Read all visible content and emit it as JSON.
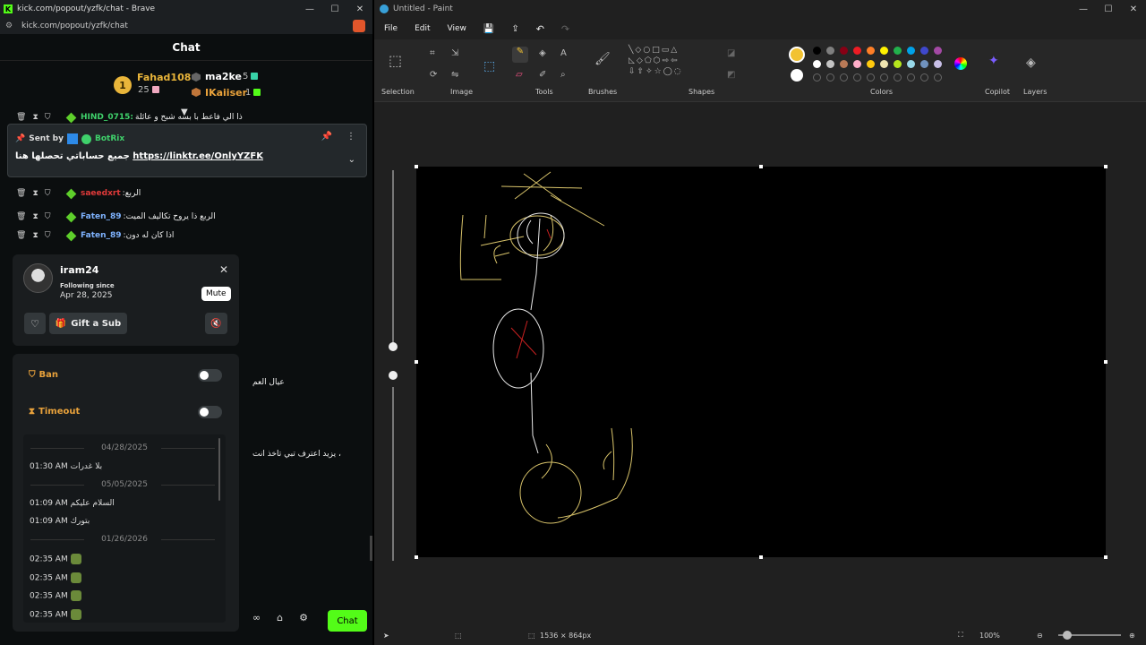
{
  "browser": {
    "title": "kick.com/popout/yzfk/chat - Brave",
    "url": "kick.com/popout/yzfk/chat",
    "window_controls": [
      "—",
      "☐",
      "✕"
    ]
  },
  "chat": {
    "header": "Chat",
    "leaderboard": {
      "first": {
        "rank": "1",
        "name": "Fahad108",
        "count": "25"
      },
      "second": {
        "name": "ma2ke",
        "count": "5"
      },
      "third": {
        "name": "IKaiiser",
        "count": "1"
      }
    },
    "cutoff_top_user": "HIND_0715:",
    "cutoff_top_text": "ذا الي فاعط با بسه شبح و عائلة",
    "pinned": {
      "sent_by": "Sent by",
      "bot_name": "BotRix",
      "text_arabic": "جميع حساباتي تحصلها هنا",
      "link": "https://linktr.ee/OnlyYZFK"
    },
    "messages": [
      {
        "user": "saeedxrt",
        "text": "الربع",
        "color": "#e03a3a"
      },
      {
        "user": "Faten_89",
        "text": "الربع ذا يروح تكاليف الميت",
        "color": "#7fb3ff"
      },
      {
        "user": "Faten_89",
        "text": "اذا كان له دون",
        "color": "#7fb3ff"
      }
    ],
    "side_text_1": "عيال العم",
    "side_text_2": "يزيد اعترف تبي تاخذ انت ،",
    "usercard": {
      "username": "iram24",
      "following_label": "Following since",
      "following_date": "Apr 28, 2025",
      "mute_tooltip": "Mute",
      "gift_label": "Gift a Sub"
    },
    "mod": {
      "ban_label": "Ban",
      "timeout_label": "Timeout"
    },
    "history": [
      {
        "date": "04/28/2025",
        "lines": [
          {
            "time": "01:30 AM",
            "text": "بلا غدرات"
          }
        ]
      },
      {
        "date": "05/05/2025",
        "lines": [
          {
            "time": "01:09 AM",
            "text": "السلام عليكم"
          },
          {
            "time": "01:09 AM",
            "text": "بتورك"
          }
        ]
      },
      {
        "date": "01/26/2026",
        "lines": [
          {
            "time": "02:35 AM",
            "text": ""
          },
          {
            "time": "02:35 AM",
            "text": ""
          },
          {
            "time": "02:35 AM",
            "text": ""
          },
          {
            "time": "02:35 AM",
            "text": ""
          }
        ]
      }
    ],
    "send_label": "Chat"
  },
  "paint": {
    "title": "Untitled - Paint",
    "menu": [
      "File",
      "Edit",
      "View"
    ],
    "groups": [
      "Selection",
      "Image",
      "Tools",
      "Brushes",
      "Shapes",
      "Colors",
      "Copilot",
      "Layers"
    ],
    "canvas_size": "1536 × 864px",
    "zoom": "100%",
    "palette": [
      "#000000",
      "#7f7f7f",
      "#880015",
      "#ed1c24",
      "#ff7f27",
      "#fff200",
      "#22b14c",
      "#00a2e8",
      "#3f48cc",
      "#a349a4",
      "#ffffff",
      "#c3c3c3",
      "#b97a57",
      "#ffaec9",
      "#ffc90e",
      "#efe4b0",
      "#b5e61d",
      "#99d9ea",
      "#7092be",
      "#c8bfe7"
    ],
    "active_color": "#f2c232"
  }
}
